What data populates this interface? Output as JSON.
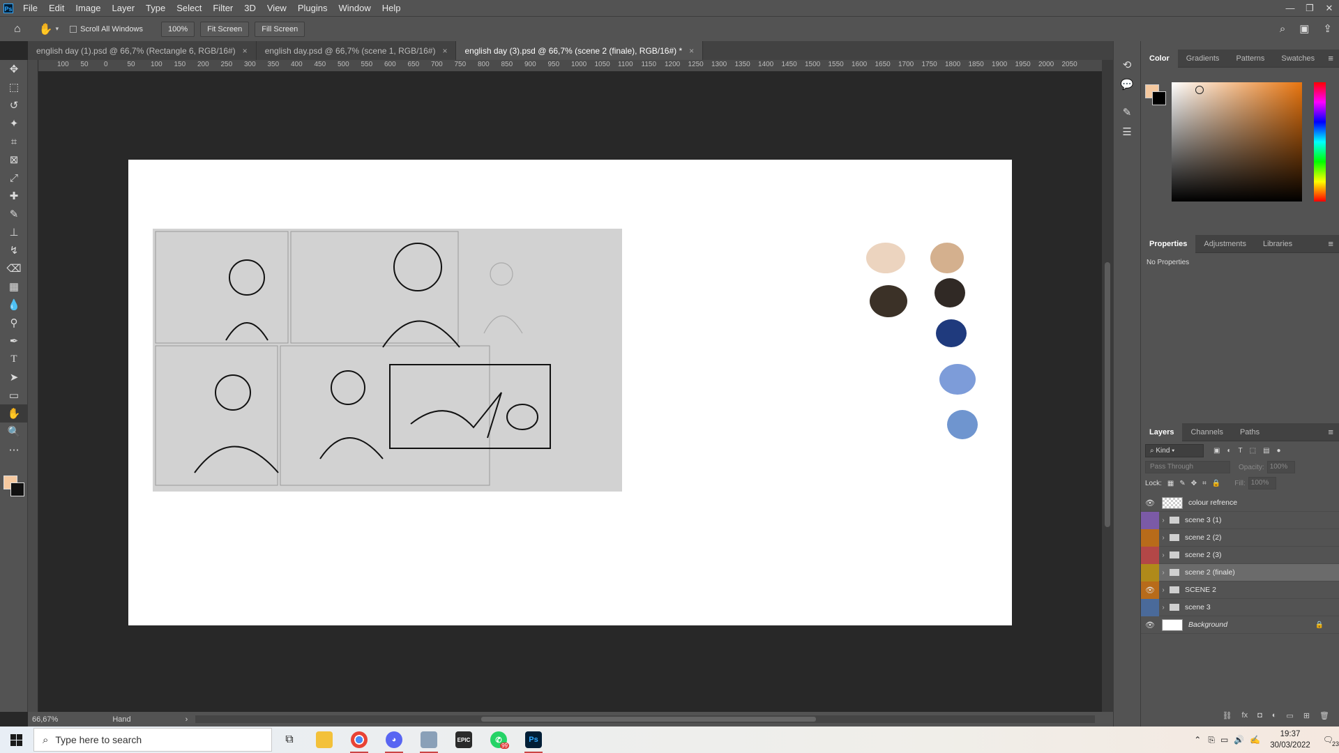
{
  "app": {
    "logo": "Ps",
    "menu": [
      "File",
      "Edit",
      "Image",
      "Layer",
      "Type",
      "Select",
      "Filter",
      "3D",
      "View",
      "Plugins",
      "Window",
      "Help"
    ]
  },
  "options": {
    "zoom": "100%",
    "scroll_all": "Scroll All Windows",
    "fit_screen": "Fit Screen",
    "fill_screen": "Fill Screen"
  },
  "tabs": [
    {
      "label": "english day (1).psd @ 66,7% (Rectangle 6, RGB/16#)"
    },
    {
      "label": "english day.psd @ 66,7% (scene 1, RGB/16#)"
    },
    {
      "label": "english day (3).psd @ 66,7% (scene 2 (finale), RGB/16#) *"
    }
  ],
  "ruler": [
    "100",
    "50",
    "0",
    "50",
    "100",
    "150",
    "200",
    "250",
    "300",
    "350",
    "400",
    "450",
    "500",
    "550",
    "600",
    "650",
    "700",
    "750",
    "800",
    "850",
    "900",
    "950",
    "1000",
    "1050",
    "1100",
    "1150",
    "1200",
    "1250",
    "1300",
    "1350",
    "1400",
    "1450",
    "1500",
    "1550",
    "1600",
    "1650",
    "1700",
    "1750",
    "1800",
    "1850",
    "1900",
    "1950",
    "2000",
    "2050"
  ],
  "status": {
    "zoom": "66,67%",
    "tool": "Hand"
  },
  "panels": {
    "color_tabs": [
      "Color",
      "Gradients",
      "Patterns",
      "Swatches"
    ],
    "props_tabs": [
      "Properties",
      "Adjustments",
      "Libraries"
    ],
    "no_props": "No Properties",
    "layers_tabs": [
      "Layers",
      "Channels",
      "Paths"
    ],
    "kind": "Kind",
    "blend": "Pass Through",
    "opacity_label": "Opacity:",
    "opacity": "100%",
    "lock_label": "Lock:",
    "fill_label": "Fill:",
    "fill": "100%",
    "fg_color": "#f5c9a0"
  },
  "layers": [
    {
      "name": "colour refrence",
      "visible": true,
      "type": "layer",
      "color": ""
    },
    {
      "name": "scene 3 (1)",
      "visible": false,
      "type": "group",
      "color": "#7b5aa6"
    },
    {
      "name": "scene 2 (2)",
      "visible": false,
      "type": "group",
      "color": "#b86b1a"
    },
    {
      "name": "scene 2 (3)",
      "visible": false,
      "type": "group",
      "color": "#b34747"
    },
    {
      "name": "scene 2 (finale)",
      "visible": false,
      "type": "group",
      "color": "#b08a1a",
      "selected": true
    },
    {
      "name": "SCENE 2",
      "visible": true,
      "type": "group",
      "color": "#b86b1a"
    },
    {
      "name": "scene 3",
      "visible": false,
      "type": "group",
      "color": "#4a6a9a"
    },
    {
      "name": "Background",
      "visible": true,
      "type": "background",
      "color": ""
    }
  ],
  "swatches": [
    "#ecd4bf",
    "#d4b08e",
    "#3b3127",
    "#302925",
    "#1f3a7d",
    "#7d9cd9",
    "#6f95cf"
  ],
  "taskbar": {
    "search": "Type here to search",
    "time": "19:37",
    "date": "30/03/2022",
    "notifications": "23",
    "whatsapp_badge": "99"
  }
}
